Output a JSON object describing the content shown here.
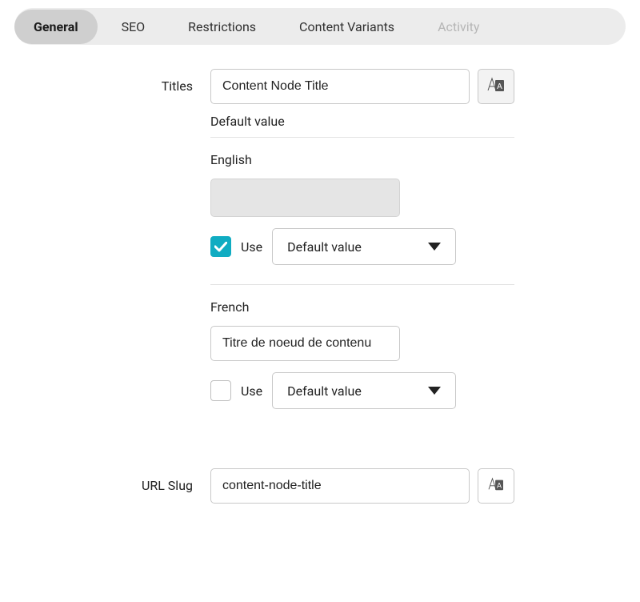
{
  "tabs": [
    {
      "label": "General",
      "state": "active"
    },
    {
      "label": "SEO",
      "state": "normal"
    },
    {
      "label": "Restrictions",
      "state": "normal"
    },
    {
      "label": "Content Variants",
      "state": "normal"
    },
    {
      "label": "Activity",
      "state": "disabled"
    }
  ],
  "titles": {
    "row_label": "Titles",
    "default_value": "Content Node Title",
    "default_caption": "Default value",
    "use_label": "Use",
    "locales": [
      {
        "name": "English",
        "value": "",
        "use_default": true,
        "select_value": "Default value"
      },
      {
        "name": "French",
        "value": "Titre de noeud de contenu",
        "use_default": false,
        "select_value": "Default value"
      }
    ]
  },
  "url_slug": {
    "row_label": "URL Slug",
    "value": "content-node-title"
  }
}
